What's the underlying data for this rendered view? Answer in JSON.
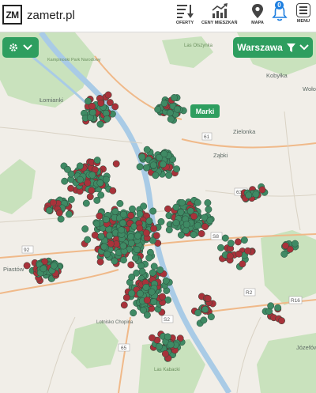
{
  "header": {
    "logo_text": "ZM",
    "site_name": "zametr.pl",
    "nav": [
      {
        "label": "OFERTY",
        "icon": "list-sort-icon"
      },
      {
        "label": "CENY MIESZKAŃ",
        "icon": "trend-chart-icon"
      },
      {
        "label": "MAPA",
        "icon": "map-pin-icon"
      },
      {
        "label": "",
        "icon": "bell-icon",
        "badge": "0"
      },
      {
        "label": "MENU",
        "icon": "hamburger-icon"
      }
    ]
  },
  "controls": {
    "city_label": "Warszawa",
    "marker_tag": "Marki"
  },
  "map_labels": {
    "lomianki": "Łomianki",
    "kobylka": "Kobyłka",
    "wolo": "Woło",
    "zielonka": "Zielonka",
    "zabki": "Ząbki",
    "piastow": "Piastów",
    "jozefow": "Józefów",
    "lasy_olszynka": "Las Olszynka",
    "kampinoski": "Kampinoski Park Narodowy",
    "lasy_kabackie": "Las Kabacki",
    "lobs_chopina": "Lotnisko Chopina",
    "road_92": "92",
    "road_61": "61",
    "road_631": "631",
    "road_s8": "S8",
    "road_r2": "R2",
    "road_s2": "S2",
    "road_r16": "R16",
    "road_e": "E",
    "road_65": "65"
  },
  "colors": {
    "brand_green": "#2e9e5f",
    "marker_green": "#3f8a64",
    "marker_red": "#a8323a",
    "water": "#a9cbe6",
    "park": "#c9e2bd"
  }
}
